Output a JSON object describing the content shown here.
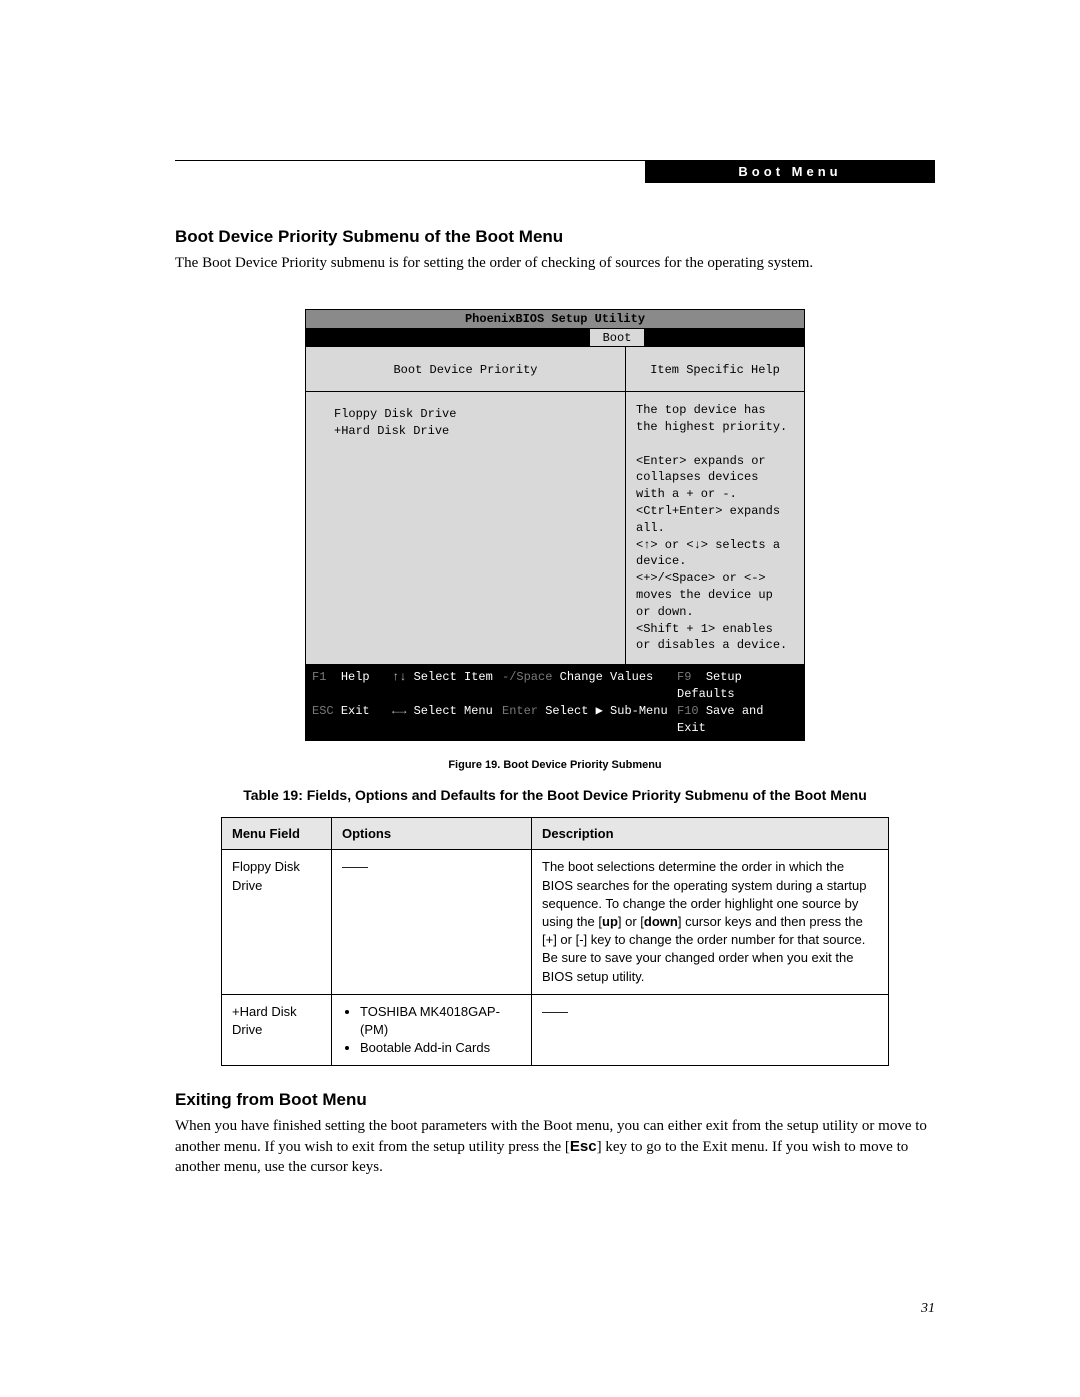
{
  "header": {
    "label": "Boot Menu"
  },
  "section1": {
    "heading": "Boot Device Priority Submenu of the Boot Menu",
    "text": "The Boot Device Priority submenu is for setting the order of checking of sources for the operating system."
  },
  "bios": {
    "title": "PhoenixBIOS Setup Utility",
    "tab": "Boot",
    "left_heading": "Boot Device Priority",
    "devices": [
      " Floppy Disk Drive",
      "+Hard Disk Drive"
    ],
    "right_heading": "Item Specific Help",
    "help": "The top device has the highest priority.\n\n<Enter> expands or collapses devices with a + or -.\n<Ctrl+Enter> expands all.\n<↑> or <↓> selects a device.\n<+>/<Space> or <-> moves the device up or down.\n<Shift + 1> enables or disables a device.",
    "footer": {
      "r1": {
        "k1": "F1",
        "v1": "Help",
        "k2": "↑↓",
        "v2": "Select Item",
        "k3": "-/Space",
        "v3": "Change Values",
        "k4": "F9",
        "v4": "Setup Defaults"
      },
      "r2": {
        "k1": "ESC",
        "v1": "Exit",
        "k2": "←→",
        "v2": "Select Menu",
        "k3": "Enter",
        "v3": "Select ▶ Sub-Menu",
        "k4": "F10",
        "v4": "Save and Exit"
      }
    }
  },
  "figure_caption": "Figure 19.  Boot Device Priority Submenu",
  "table_title": "Table 19: Fields, Options and Defaults for the Boot Device Priority Submenu of the Boot Menu",
  "table": {
    "headers": [
      "Menu Field",
      "Options",
      "Description"
    ],
    "rows": [
      {
        "field": "Floppy Disk Drive",
        "options_plain": "——",
        "desc_pre": "The boot selections determine the order in which the BIOS searches for the operating system during a startup sequence. To change the order highlight one source by using the [",
        "up": "up",
        "desc_mid1": "] or [",
        "down": "down",
        "desc_mid2": "] cursor keys and then press the [+] or [-] key to change the order number for that source. Be sure to save your changed order when you exit the BIOS setup utility."
      },
      {
        "field": "+Hard Disk Drive",
        "options_list": [
          "TOSHIBA MK4018GAP-(PM)",
          "Bootable Add-in Cards"
        ],
        "desc_plain": "——"
      }
    ]
  },
  "section2": {
    "heading": "Exiting from Boot Menu",
    "text_pre": "When you have finished setting the boot parameters with the Boot menu, you can either exit from the setup utility or move to another menu. If you wish to exit from the setup utility press the [",
    "esc": "Esc",
    "text_post": "] key to go to the Exit menu. If you wish to move to another menu, use the cursor keys."
  },
  "page_number": "31"
}
